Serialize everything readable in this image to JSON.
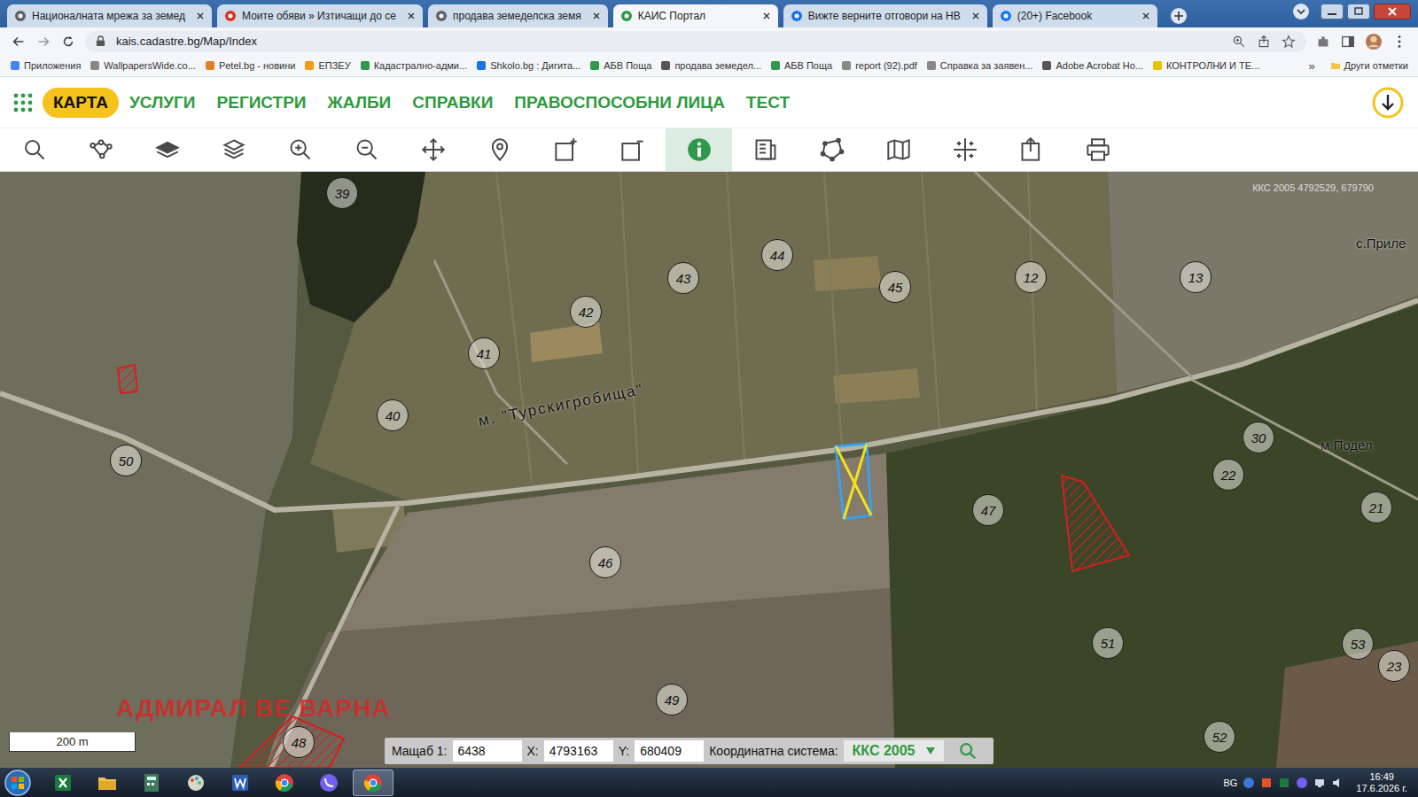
{
  "browser": {
    "tabs": [
      {
        "label": "Националната мрежа за земед",
        "selected": false,
        "color": "#5f6368"
      },
      {
        "label": "Моите обяви » Изтичащи до се",
        "selected": false,
        "color": "#d93025"
      },
      {
        "label": "продава земеделска земя",
        "selected": false,
        "color": "#5f6368"
      },
      {
        "label": "КАИС Портал",
        "selected": true,
        "color": "#2e9a4a"
      },
      {
        "label": "Вижте верните отговори на НВ",
        "selected": false,
        "color": "#1a73e8"
      },
      {
        "label": "(20+) Facebook",
        "selected": false,
        "color": "#1877f2"
      }
    ],
    "url": "kais.cadastre.bg/Map/Index",
    "bookmarks": [
      {
        "label": "Приложения",
        "color": "#4285f4"
      },
      {
        "label": "WallpapersWide.co...",
        "color": "#888888"
      },
      {
        "label": "Petel.bg - новини",
        "color": "#e67e22"
      },
      {
        "label": "ЕПЗЕУ",
        "color": "#f39c12"
      },
      {
        "label": "Кадастрално-адми...",
        "color": "#2e9a4a"
      },
      {
        "label": "Shkolo.bg : Дигита...",
        "color": "#1a73e8"
      },
      {
        "label": "АБВ Поща",
        "color": "#2e9a4a"
      },
      {
        "label": "продава земедел...",
        "color": "#555555"
      },
      {
        "label": "АБВ Поща",
        "color": "#2e9a4a"
      },
      {
        "label": "report (92).pdf",
        "color": "#888888"
      },
      {
        "label": "Справка за заявен...",
        "color": "#888888"
      },
      {
        "label": "Adobe Acrobat Ho...",
        "color": "#555555"
      },
      {
        "label": "КОНТРОЛНИ И ТЕ...",
        "color": "#e6c200"
      }
    ],
    "more": "»",
    "other_bookmarks": "Други отметки"
  },
  "nav": {
    "items": [
      {
        "label": "КАРТА",
        "selected": true
      },
      {
        "label": "УСЛУГИ",
        "selected": false
      },
      {
        "label": "РЕГИСТРИ",
        "selected": false
      },
      {
        "label": "ЖАЛБИ",
        "selected": false
      },
      {
        "label": "СПРАВКИ",
        "selected": false
      },
      {
        "label": "ПРАВОСПОСОБНИ ЛИЦА",
        "selected": false
      },
      {
        "label": "ТЕСТ",
        "selected": false
      }
    ]
  },
  "toolbar": {
    "tools": [
      {
        "kind": "search",
        "selected": false
      },
      {
        "kind": "route",
        "selected": false
      },
      {
        "kind": "layer",
        "selected": false
      },
      {
        "kind": "layers",
        "selected": false
      },
      {
        "kind": "zoom-in",
        "selected": false
      },
      {
        "kind": "zoom-out",
        "selected": false
      },
      {
        "kind": "pan",
        "selected": false
      },
      {
        "kind": "pin",
        "selected": false
      },
      {
        "kind": "select-add",
        "selected": false
      },
      {
        "kind": "select-remove",
        "selected": false
      },
      {
        "kind": "info",
        "selected": true
      },
      {
        "kind": "measure",
        "selected": false
      },
      {
        "kind": "polygon",
        "selected": false
      },
      {
        "kind": "map",
        "selected": false
      },
      {
        "kind": "grid",
        "selected": false
      },
      {
        "kind": "export",
        "selected": false
      },
      {
        "kind": "print",
        "selected": false
      }
    ]
  },
  "map": {
    "parcels": [
      {
        "label": "39"
      },
      {
        "label": "44"
      },
      {
        "label": "43"
      },
      {
        "label": "45"
      },
      {
        "label": "12"
      },
      {
        "label": "13"
      },
      {
        "label": "42"
      },
      {
        "label": "41"
      },
      {
        "label": "40"
      },
      {
        "label": "50"
      },
      {
        "label": "47"
      },
      {
        "label": "22"
      },
      {
        "label": "30"
      },
      {
        "label": "21"
      },
      {
        "label": "46"
      },
      {
        "label": "51"
      },
      {
        "label": "53"
      },
      {
        "label": "23"
      },
      {
        "label": "52"
      },
      {
        "label": "49"
      },
      {
        "label": "48"
      }
    ],
    "places": [
      {
        "label": "м. \"Турскигробища\""
      },
      {
        "label": "м.Подел"
      },
      {
        "label": "с.Приле"
      }
    ],
    "highlights": [
      {
        "kind": "selected"
      },
      {
        "kind": "hatched"
      },
      {
        "kind": "hatched"
      },
      {
        "kind": "hatched"
      }
    ],
    "watermark": "АДМИРАЛ ВЕ ВАРНА",
    "corner_coords": "ККС 2005 4792529, 679790",
    "scale_bar": "200 m"
  },
  "coordinates": {
    "scale_label": "Мащаб 1:",
    "scale": "6438",
    "x_label": "X:",
    "x": "4793163",
    "y_label": "Y:",
    "y": "680409",
    "crs_label": "Координатна система:",
    "crs": "ККС 2005"
  },
  "taskbar": {
    "apps": [
      {
        "kind": "excel",
        "active": false
      },
      {
        "kind": "explorer",
        "active": false
      },
      {
        "kind": "ledger",
        "active": false
      },
      {
        "kind": "paint",
        "active": false
      },
      {
        "kind": "word",
        "active": false
      },
      {
        "kind": "chrome",
        "active": false
      },
      {
        "kind": "viber",
        "active": false
      },
      {
        "kind": "chrome",
        "active": true
      }
    ],
    "lang": "BG",
    "time": "16:49",
    "date": "17.6.2026 г."
  }
}
